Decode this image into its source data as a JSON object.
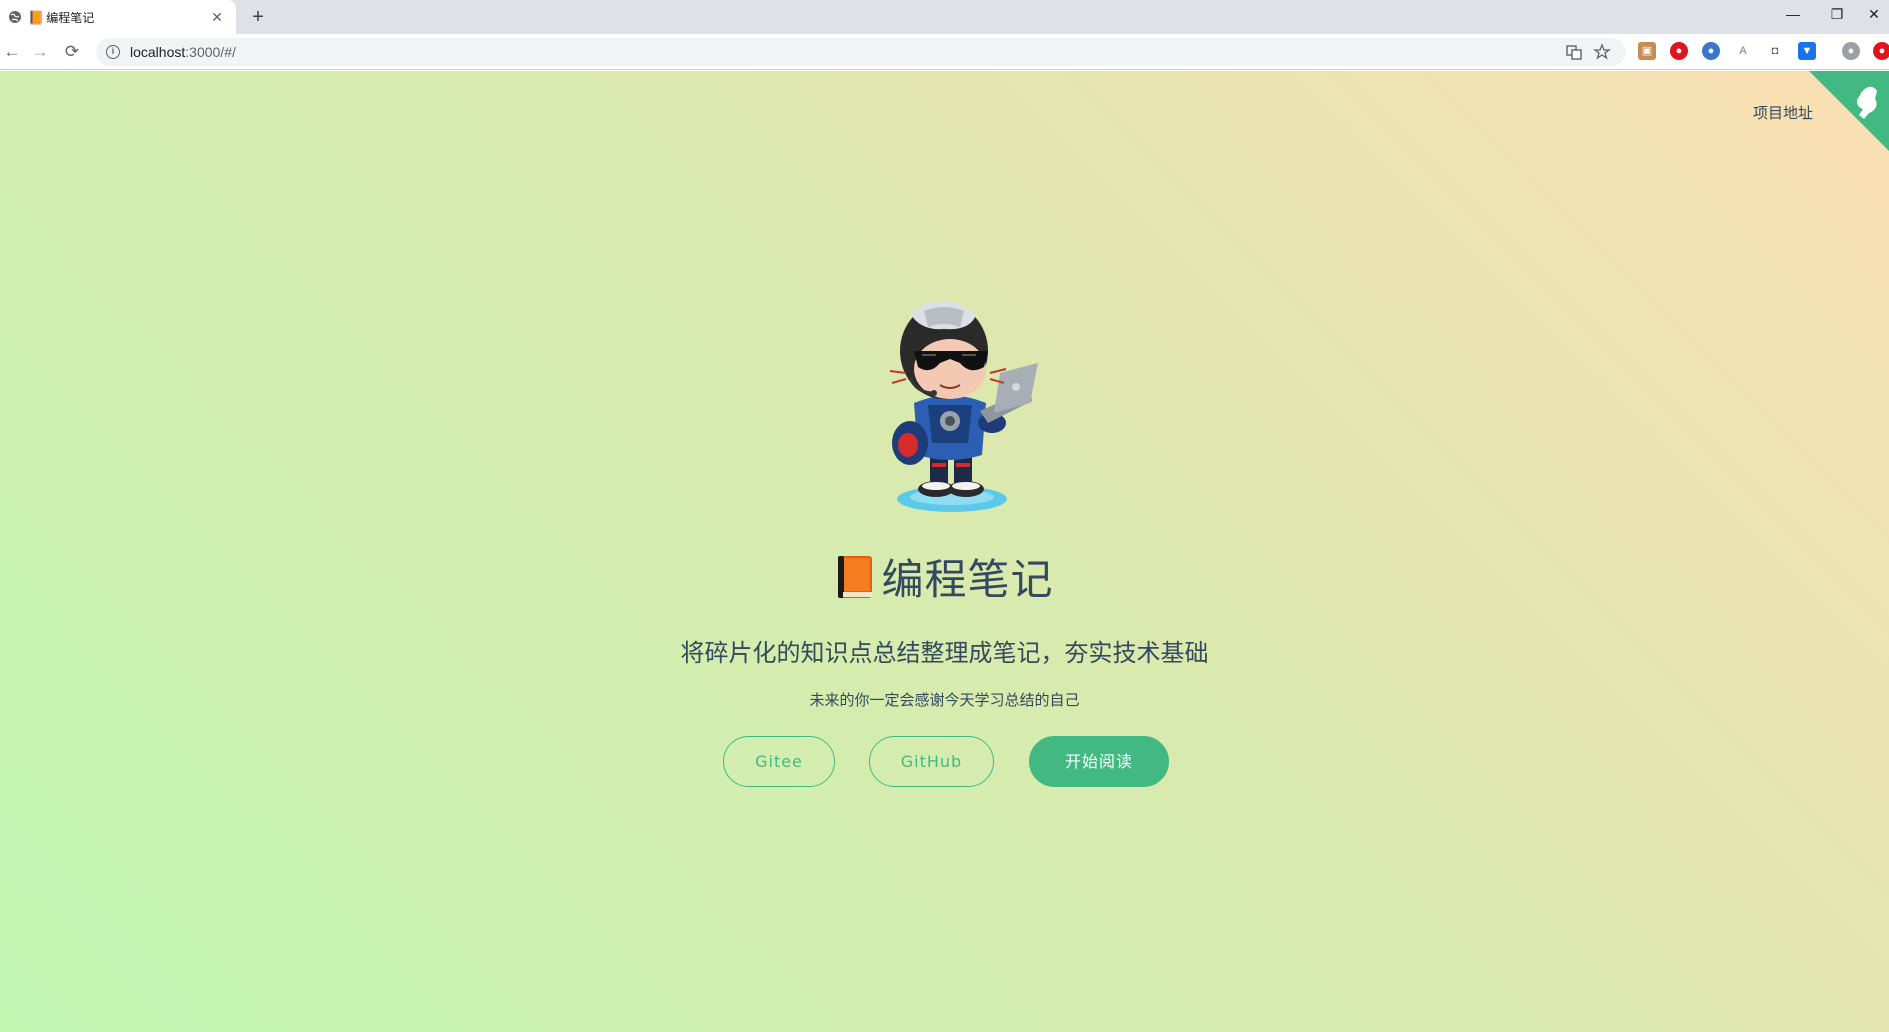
{
  "browser": {
    "tab": {
      "title": "编程笔记",
      "favicon": "📙",
      "close_label": "✕"
    },
    "new_tab_label": "+",
    "window_controls": {
      "minimize": "—",
      "maximize": "❐",
      "close": "✕"
    },
    "nav": {
      "back": "←",
      "forward": "→",
      "reload": "⟳"
    },
    "address": {
      "host": "localhost",
      "path": ":3000/#/"
    },
    "icons": [
      "translate-icon",
      "bookmark-star-icon"
    ],
    "extensions": [
      {
        "name": "extension-1-icon",
        "color": "#c98b54",
        "glyph": "▣"
      },
      {
        "name": "extension-2-icon",
        "color": "#e0151c",
        "glyph": "●"
      },
      {
        "name": "extension-3-icon",
        "color": "#3b77c9",
        "glyph": "●"
      },
      {
        "name": "extension-4-icon",
        "color": "#9aa0a6",
        "glyph": "A"
      },
      {
        "name": "extension-5-icon",
        "color": "#5f6368",
        "glyph": "◘"
      },
      {
        "name": "extension-6-icon",
        "color": "#1a73e8",
        "glyph": "▼"
      },
      {
        "name": "profile-icon",
        "color": "#9aa0a6",
        "glyph": "●"
      },
      {
        "name": "extension-7-icon",
        "color": "#e0151c",
        "glyph": "●"
      }
    ]
  },
  "page": {
    "project_link": "项目地址",
    "title": "编程笔记",
    "title_icon": "book-icon",
    "tagline": "将碎片化的知识点总结整理成笔记，夯实技术基础",
    "subline": "未来的你一定会感谢今天学习总结的自己",
    "buttons": {
      "gitee": "Gitee",
      "github": "GitHub",
      "start": "开始阅读"
    },
    "accent_color": "#42b983",
    "text_color": "#34495e"
  }
}
